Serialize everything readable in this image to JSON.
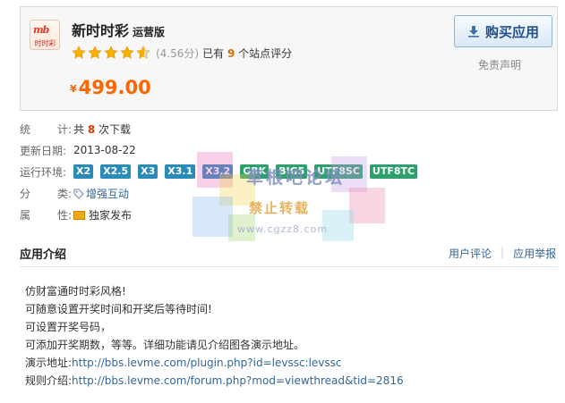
{
  "app": {
    "logo_text_top": "mb",
    "logo_text_bottom": "时时彩",
    "title": "新时时彩",
    "edition": "运营版",
    "rating_stars": 4.56,
    "rating_score": "(4.56分)",
    "rating_prefix": "已有",
    "rating_count": "9",
    "rating_suffix": "个站点评分",
    "price_currency": "¥",
    "price": "499.00",
    "buy_label": "购买应用",
    "disclaimer": "免责声明"
  },
  "info": {
    "stats_label": [
      "统",
      "计:"
    ],
    "stats_prefix": "共",
    "stats_count": "8",
    "stats_suffix": "次下载",
    "updated_label": "更新日期:",
    "updated_value": "2013-08-22",
    "env_label": "运行环境:",
    "env_tags": [
      {
        "text": "X2",
        "color": "blue"
      },
      {
        "text": "X2.5",
        "color": "blue"
      },
      {
        "text": "X3",
        "color": "blue"
      },
      {
        "text": "X3.1",
        "color": "blue"
      },
      {
        "text": "X3.2",
        "color": "blue"
      },
      {
        "text": "GBK",
        "color": "green"
      },
      {
        "text": "BIG5",
        "color": "green"
      },
      {
        "text": "UTF8SC",
        "color": "green"
      },
      {
        "text": "UTF8TC",
        "color": "green"
      }
    ],
    "category_label": [
      "分",
      "类:"
    ],
    "category_value": "增强互动",
    "attr_label": [
      "属",
      "性:"
    ],
    "attr_value": "独家发布"
  },
  "section": {
    "title": "应用介绍",
    "link_reviews": "用户评论",
    "link_report": "应用举报"
  },
  "description": {
    "line1": "仿财富通时时彩风格!",
    "line2": "可随意设置开奖时间和开奖后等待时间!",
    "line3": "可设置开奖号码，",
    "line4": "可添加开奖期数，等等。详细功能请见介绍图各演示地址。",
    "demo_label": "演示地址:",
    "demo_url": "http://bbs.levme.com/plugin.php?id=levssc:levssc",
    "rules_label": "规则介绍:",
    "rules_url": "http://bbs.levme.com/forum.php?mod=viewthread&tid=2816"
  },
  "watermark": {
    "title": "草根吧论坛",
    "subtitle": "禁止转载",
    "url": "www.cgzz8.com"
  },
  "colors": {
    "price": "#ff6600",
    "link": "#336699",
    "env_blue": "#2a8ab8",
    "env_green": "#2e9f6e",
    "star": "#f5b000"
  }
}
